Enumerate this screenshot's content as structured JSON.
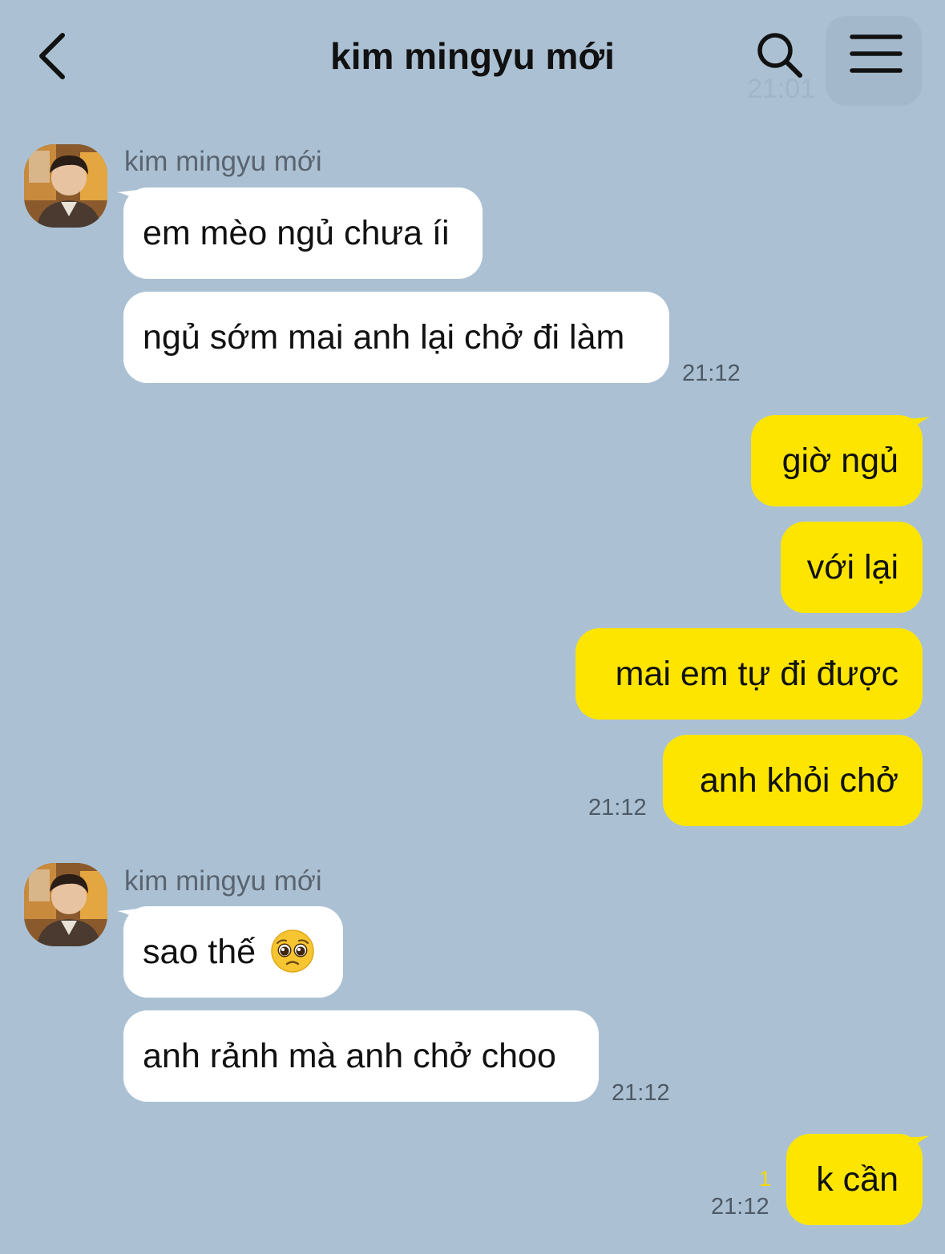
{
  "header": {
    "title": "kim mingyu mới",
    "ghost_time": "21:01"
  },
  "messages": [
    {
      "sender_name": "kim mingyu mới",
      "text": "em mèo ngủ chưa íi"
    },
    {
      "text": "ngủ sớm mai anh lại chở đi làm",
      "time": "21:12"
    },
    {
      "text": "giờ ngủ"
    },
    {
      "text": "với lại"
    },
    {
      "text": "mai em tự đi được"
    },
    {
      "text": "anh khỏi chở",
      "time": "21:12"
    },
    {
      "sender_name": "kim mingyu mới",
      "text": "sao thế",
      "emoji": "pleading-face"
    },
    {
      "text": "anh rảnh mà anh chở choo",
      "time": "21:12"
    },
    {
      "text": "k cần",
      "time": "21:12",
      "unread": "1"
    }
  ],
  "colors": {
    "background": "#abc1d3",
    "incoming_bubble": "#ffffff",
    "outgoing_bubble": "#fde500",
    "unread_count": "#f5d800"
  }
}
